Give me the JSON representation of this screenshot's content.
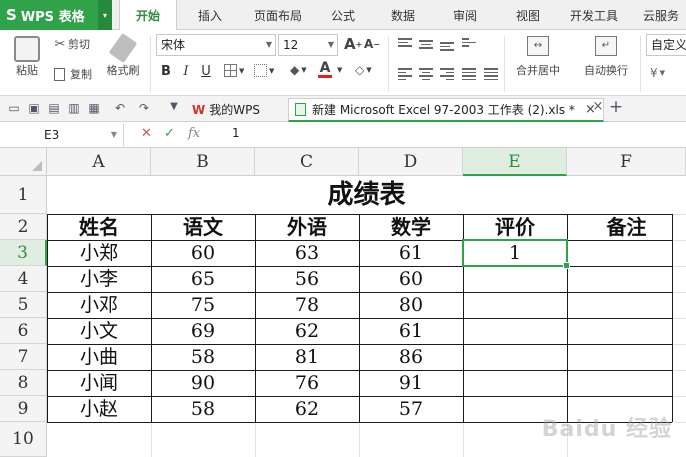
{
  "app": {
    "logo": "S",
    "name": "WPS 表格"
  },
  "menu_tabs": [
    "开始",
    "插入",
    "页面布局",
    "公式",
    "数据",
    "审阅",
    "视图",
    "开发工具",
    "云服务"
  ],
  "active_menu_tab": "开始",
  "ribbon": {
    "clipboard": {
      "paste": "粘贴",
      "cut": "剪切",
      "copy": "复制",
      "format_painter": "格式刷"
    },
    "font": {
      "name": "宋体",
      "size": "12",
      "grow": "A",
      "shrink": "A"
    },
    "format_buttons": [
      "B",
      "I",
      "U"
    ],
    "font_color_letter": "A",
    "merge_center": "合并居中",
    "wrap_text": "自动换行",
    "number_format": "自定义"
  },
  "document_tabs": [
    {
      "label": "我的WPS",
      "active": false
    },
    {
      "label": "新建 Microsoft Excel 97-2003 工作表 (2).xls *",
      "active": true
    }
  ],
  "formula_bar": {
    "name_box": "E3",
    "fx": "fx",
    "value": "1"
  },
  "grid": {
    "columns": [
      "A",
      "B",
      "C",
      "D",
      "E",
      "F"
    ],
    "rows": [
      "1",
      "2",
      "3",
      "4",
      "5",
      "6",
      "7",
      "8",
      "9",
      "10"
    ],
    "selected_column": "E",
    "selected_row": "3",
    "title": "成绩表",
    "headers": [
      "姓名",
      "语文",
      "外语",
      "数学",
      "评价",
      "备注"
    ],
    "records": [
      [
        "小郑",
        "60",
        "63",
        "61",
        "1",
        ""
      ],
      [
        "小李",
        "65",
        "56",
        "60",
        "",
        ""
      ],
      [
        "小邓",
        "75",
        "78",
        "80",
        "",
        ""
      ],
      [
        "小文",
        "69",
        "62",
        "61",
        "",
        ""
      ],
      [
        "小曲",
        "58",
        "81",
        "86",
        "",
        ""
      ],
      [
        "小闻",
        "90",
        "76",
        "91",
        "",
        ""
      ],
      [
        "小赵",
        "58",
        "62",
        "57",
        "",
        ""
      ]
    ]
  },
  "watermark": "Baidu 经验",
  "colors": {
    "accent": "#2fa24a",
    "selection_header": "#dfeee0",
    "cancel": "#d9534f",
    "confirm": "#2fa24a"
  }
}
